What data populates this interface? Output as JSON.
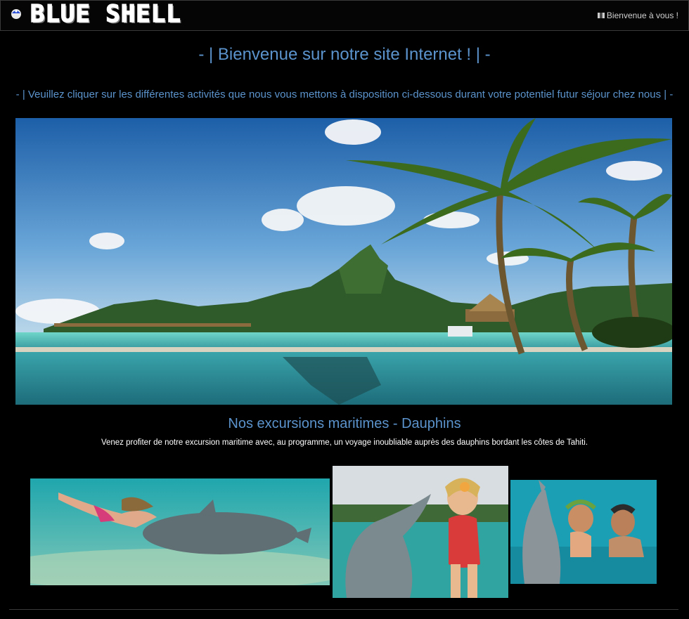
{
  "header": {
    "logo_text": "BLUE SHELL",
    "logo_icon": "blue-shell-icon",
    "welcome_text": "Bienvenue à vous !",
    "welcome_icon": "flag-icon"
  },
  "main": {
    "headline": "- | Bienvenue sur notre site Internet ! | -",
    "subline": "- | Veuillez cliquer sur les différentes activités que nous vous mettons à disposition ci-dessous durant votre potentiel futur séjour chez nous | -",
    "section_title": "Nos excursions maritimes - Dauphins",
    "section_desc": "Venez profiter de notre excursion maritime avec, au programme, un voyage inoubliable auprès des dauphins bordant les côtes de Tahiti."
  },
  "colors": {
    "accent": "#5b93cc",
    "background": "#000000"
  }
}
